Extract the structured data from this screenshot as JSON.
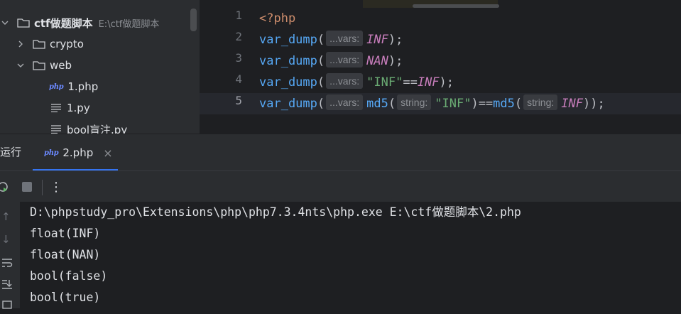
{
  "project": {
    "root": {
      "name": "ctf做题脚本",
      "path": "E:\\ctf做题脚本"
    },
    "items": [
      {
        "label": "crypto",
        "type": "folder",
        "expanded": false
      },
      {
        "label": "web",
        "type": "folder",
        "expanded": true
      },
      {
        "label": "1.php",
        "type": "php-file"
      },
      {
        "label": "1.py",
        "type": "text-file"
      },
      {
        "label": "bool盲注.py",
        "type": "text-file"
      }
    ]
  },
  "editor": {
    "line_numbers": [
      "1",
      "2",
      "3",
      "4",
      "5"
    ],
    "code": {
      "l1": {
        "open_tag": "<?php"
      },
      "l2": {
        "fn": "var_dump",
        "open": "(",
        "hint": "...vars:",
        "const": "INF",
        "close": ");"
      },
      "l3": {
        "fn": "var_dump",
        "open": "(",
        "hint": "...vars:",
        "const": "NAN",
        "close": ");"
      },
      "l4": {
        "fn": "var_dump",
        "open": "(",
        "hint": "...vars:",
        "str": "\"INF\"",
        "op": "==",
        "const": "INF",
        "close": ");"
      },
      "l5": {
        "fn": "var_dump",
        "open": "(",
        "hint": "...vars:",
        "fn2": "md5",
        "open2": "(",
        "hint2": "string:",
        "str": "\"INF\"",
        "close2": ")",
        "op": "==",
        "fn3": "md5",
        "open3": "(",
        "hint3": "string:",
        "const": "INF",
        "close": "));"
      }
    },
    "active_line": 5
  },
  "run_panel": {
    "title": "运行",
    "tab": {
      "icon_text": "php",
      "label": "2.php",
      "close": "×"
    },
    "toolbar": {
      "more": "⋮"
    },
    "console_lines": [
      "D:\\phpstudy_pro\\Extensions\\php\\php7.3.4nts\\php.exe E:\\ctf做题脚本\\2.php",
      "float(INF)",
      "float(NAN)",
      "bool(false)",
      "bool(true)"
    ]
  },
  "icons": {
    "php_badge": "php",
    "side": [
      "↑",
      "↓"
    ]
  },
  "colors": {
    "accent": "#3574f0",
    "keyword": "#cf8e6d",
    "function": "#56a8f5",
    "constant": "#c77dbb",
    "string": "#6aab73"
  }
}
